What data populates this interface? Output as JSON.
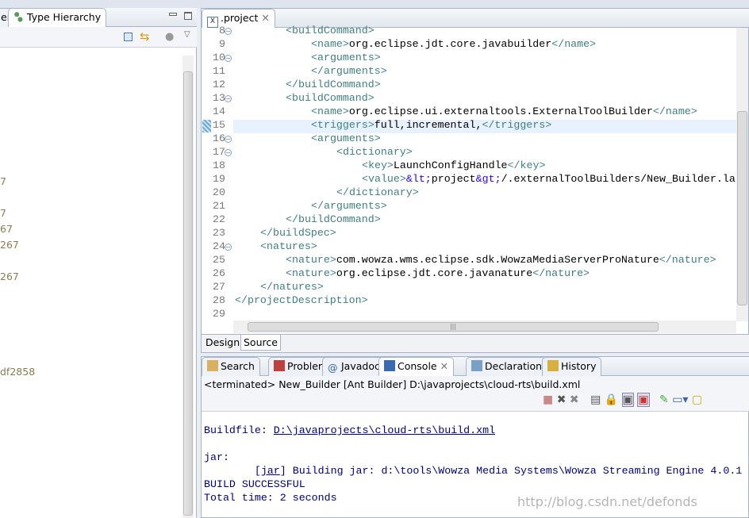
{
  "left_panel": {
    "tabs": [
      {
        "label": "er"
      },
      {
        "label": "Type Hierarchy"
      }
    ],
    "fragments": [
      "7",
      "7",
      "67",
      "267",
      "267",
      "df2858"
    ]
  },
  "editor": {
    "tab": {
      "label": ".project"
    },
    "lines": [
      {
        "n": "8",
        "fold": true,
        "indent": 2,
        "tokens": [
          [
            "t",
            "<buildCommand>"
          ]
        ]
      },
      {
        "n": "9",
        "indent": 3,
        "tokens": [
          [
            "t",
            "<name>"
          ],
          [
            "x",
            "org.eclipse.jdt.core.javabuilder"
          ],
          [
            "t",
            "</name>"
          ]
        ]
      },
      {
        "n": "10",
        "fold": true,
        "indent": 3,
        "tokens": [
          [
            "t",
            "<arguments>"
          ]
        ]
      },
      {
        "n": "11",
        "indent": 3,
        "tokens": [
          [
            "t",
            "</arguments>"
          ]
        ]
      },
      {
        "n": "12",
        "indent": 2,
        "tokens": [
          [
            "t",
            "</buildCommand>"
          ]
        ]
      },
      {
        "n": "13",
        "fold": true,
        "indent": 2,
        "tokens": [
          [
            "t",
            "<buildCommand>"
          ]
        ]
      },
      {
        "n": "14",
        "indent": 3,
        "tokens": [
          [
            "t",
            "<name>"
          ],
          [
            "x",
            "org.eclipse.ui.externaltools.ExternalToolBuilder"
          ],
          [
            "t",
            "</name>"
          ]
        ]
      },
      {
        "n": "15",
        "indent": 3,
        "current": true,
        "tokens": [
          [
            "t",
            "<triggers>"
          ],
          [
            "x",
            "full,incremental,"
          ],
          [
            "t",
            "</triggers>"
          ]
        ]
      },
      {
        "n": "16",
        "fold": true,
        "indent": 3,
        "tokens": [
          [
            "t",
            "<arguments>"
          ]
        ]
      },
      {
        "n": "17",
        "fold": true,
        "indent": 4,
        "tokens": [
          [
            "t",
            "<dictionary>"
          ]
        ]
      },
      {
        "n": "18",
        "indent": 5,
        "tokens": [
          [
            "t",
            "<key>"
          ],
          [
            "x",
            "LaunchConfigHandle"
          ],
          [
            "t",
            "</key>"
          ]
        ]
      },
      {
        "n": "19",
        "indent": 5,
        "tokens": [
          [
            "t",
            "<value>"
          ],
          [
            "e",
            "&lt;"
          ],
          [
            "x",
            "project"
          ],
          [
            "e",
            "&gt;"
          ],
          [
            "x",
            "/.externalToolBuilders/New_Builder.la"
          ]
        ]
      },
      {
        "n": "20",
        "indent": 4,
        "tokens": [
          [
            "t",
            "</dictionary>"
          ]
        ]
      },
      {
        "n": "21",
        "indent": 3,
        "tokens": [
          [
            "t",
            "</arguments>"
          ]
        ]
      },
      {
        "n": "22",
        "indent": 2,
        "tokens": [
          [
            "t",
            "</buildCommand>"
          ]
        ]
      },
      {
        "n": "23",
        "indent": 1,
        "tokens": [
          [
            "t",
            "</buildSpec>"
          ]
        ]
      },
      {
        "n": "24",
        "fold": true,
        "indent": 1,
        "tokens": [
          [
            "t",
            "<natures>"
          ]
        ]
      },
      {
        "n": "25",
        "indent": 2,
        "tokens": [
          [
            "t",
            "<nature>"
          ],
          [
            "x",
            "com.wowza.wms.eclipse.sdk.WowzaMediaServerProNature"
          ],
          [
            "t",
            "</nature>"
          ]
        ]
      },
      {
        "n": "26",
        "indent": 2,
        "tokens": [
          [
            "t",
            "<nature>"
          ],
          [
            "x",
            "org.eclipse.jdt.core.javanature"
          ],
          [
            "t",
            "</nature>"
          ]
        ]
      },
      {
        "n": "27",
        "indent": 1,
        "tokens": [
          [
            "t",
            "</natures>"
          ]
        ]
      },
      {
        "n": "28",
        "indent": 0,
        "tokens": [
          [
            "t",
            "</projectDescription>"
          ]
        ]
      },
      {
        "n": "29",
        "indent": 0,
        "tokens": []
      }
    ],
    "bottom_tabs": [
      {
        "label": "Design"
      },
      {
        "label": "Source"
      }
    ]
  },
  "console": {
    "tabs": [
      {
        "label": "Search",
        "icon": "search-icon"
      },
      {
        "label": "Problems",
        "icon": "problems-icon"
      },
      {
        "label": "Javadoc",
        "icon": "at-icon"
      },
      {
        "label": "Console",
        "icon": "console-icon",
        "active": true
      },
      {
        "label": "Declaration",
        "icon": "declaration-icon"
      },
      {
        "label": "History",
        "icon": "history-icon"
      }
    ],
    "status": "<terminated> New_Builder [Ant Builder] D:\\javaprojects\\cloud-rts\\build.xml",
    "output": {
      "buildfile_label": "Buildfile: ",
      "buildfile_path": "D:\\javaprojects\\cloud-rts\\build.xml",
      "target": "jar:",
      "jar_prefix": "        [",
      "jar_tag": "jar",
      "jar_msg": "] Building jar: d:\\tools\\Wowza Media Systems\\Wowza Streaming Engine 4.0.1",
      "result": "BUILD SUCCESSFUL",
      "time": "Total time: 2 seconds"
    }
  },
  "watermark": "http://blog.csdn.net/defonds",
  "colors": {
    "tag": "#3f7f7f",
    "entity": "#2a00ff",
    "console_text": "#000080",
    "current_line": "#e8f2fe"
  }
}
